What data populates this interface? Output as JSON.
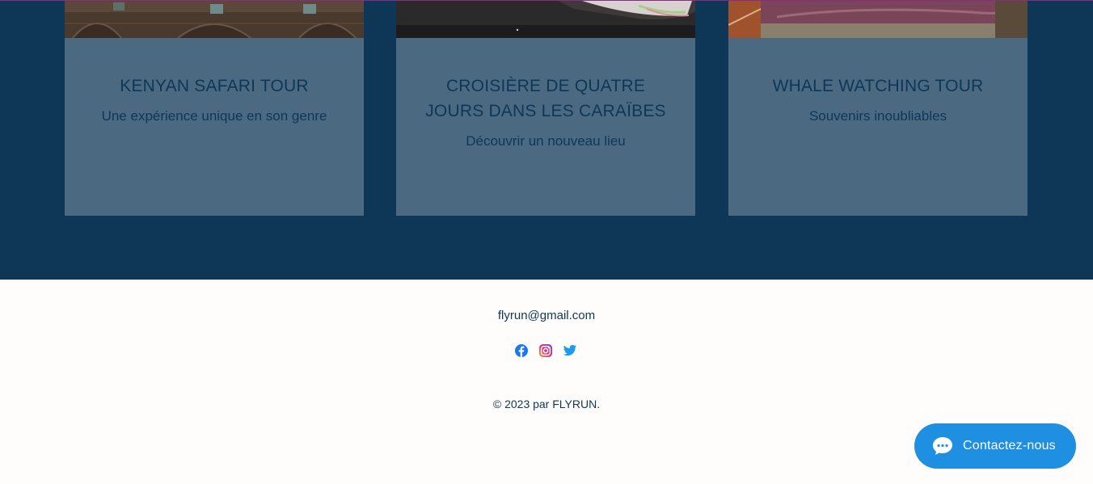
{
  "cards": [
    {
      "title": "KENYAN SAFARI TOUR",
      "subtitle": "Une expérience unique en son genre"
    },
    {
      "title": "CROISIÈRE DE QUATRE JOURS DANS LES CARAÏBES",
      "subtitle": "Découvrir un nouveau lieu"
    },
    {
      "title": "WHALE WATCHING TOUR",
      "subtitle": "Souvenirs inoubliables"
    }
  ],
  "footer": {
    "email": "flyrun@gmail.com",
    "social_icons": [
      "facebook-icon",
      "instagram-icon",
      "twitter-icon"
    ],
    "copyright": "© 2023 par FLYRUN."
  },
  "chat": {
    "label": "Contactez-nous",
    "icon": "chat-bubble-icon"
  },
  "colors": {
    "section_bg": "#0e3757",
    "card_bg": "#4b6a82",
    "footer_bg": "#fefdfb",
    "chat_bg": "#1e8fe1",
    "facebook": "#1877f2",
    "twitter": "#1d9bf0"
  }
}
